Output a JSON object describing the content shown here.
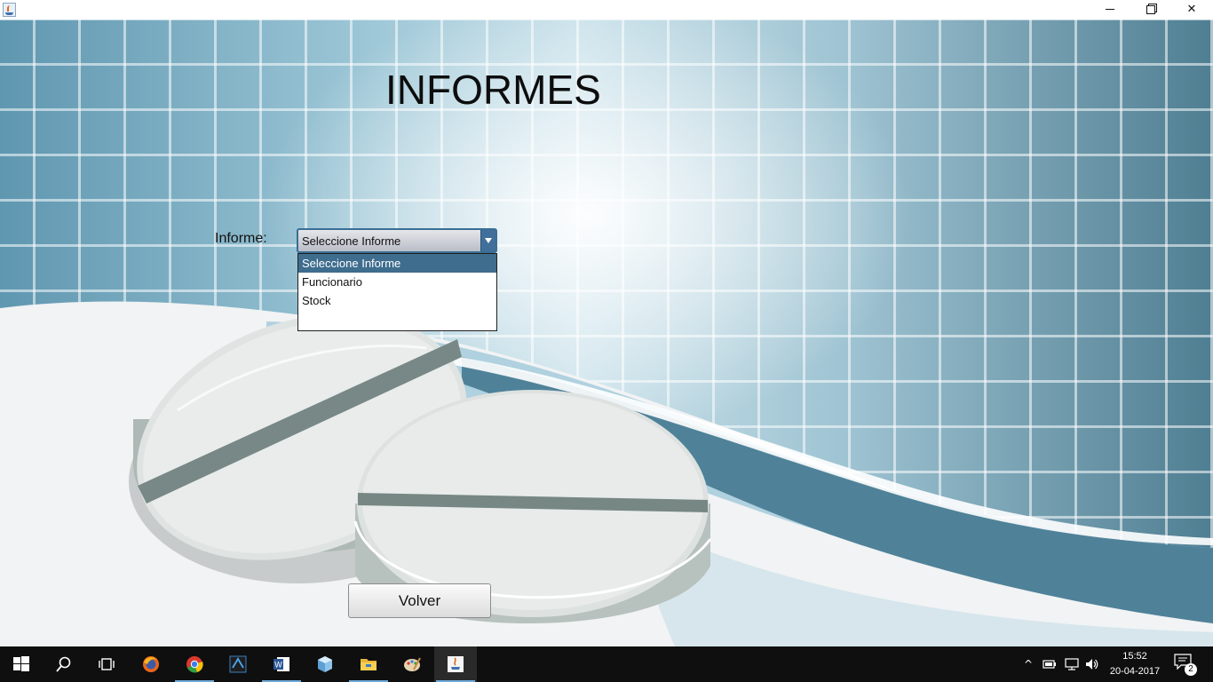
{
  "window": {
    "minimize_glyph": "",
    "restore_glyph": "",
    "close_glyph": "✕"
  },
  "main": {
    "title": "INFORMES",
    "informe_label": "Informe:",
    "combo": {
      "selected": "Seleccione Informe",
      "options": [
        "Seleccione Informe",
        "Funcionario",
        "Stock"
      ],
      "highlighted_index": 0
    },
    "volver_button": "Volver"
  },
  "taskbar": {
    "apps": [
      "windows-start",
      "search",
      "task-view",
      "firefox",
      "chrome",
      "visual-studio",
      "word",
      "virtualbox",
      "file-explorer",
      "paint",
      "java"
    ],
    "time": "15:52",
    "date": "20-04-2017",
    "notification_count": "2",
    "tray_chevron": "^"
  },
  "colors": {
    "accent": "#3e6d8e",
    "taskbar": "#0f0f0f"
  }
}
